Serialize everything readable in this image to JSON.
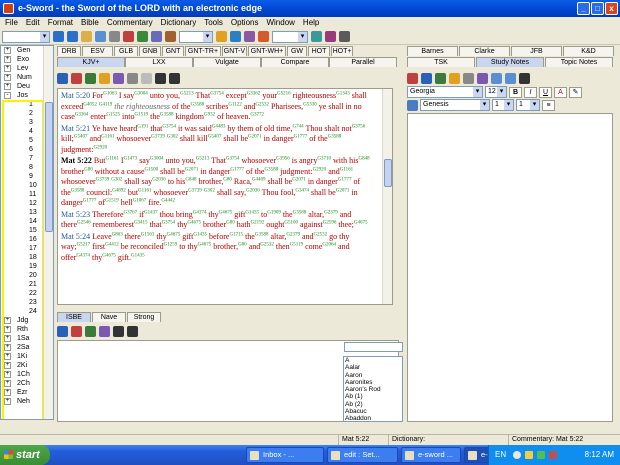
{
  "window": {
    "title": "e-Sword - the Sword of the LORD with an electronic edge",
    "minimize": "_",
    "maximize": "□",
    "close": "x"
  },
  "menu": [
    "File",
    "Edit",
    "Format",
    "Bible",
    "Commentary",
    "Dictionary",
    "Tools",
    "Options",
    "Window",
    "Help"
  ],
  "sidebar": {
    "books_top": [
      {
        "pm": "+",
        "name": "Gen"
      },
      {
        "pm": "+",
        "name": "Exo"
      },
      {
        "pm": "+",
        "name": "Lev"
      },
      {
        "pm": "+",
        "name": "Num"
      },
      {
        "pm": "+",
        "name": "Deu"
      },
      {
        "pm": "-",
        "name": "Jos"
      }
    ],
    "chapters": [
      "1",
      "2",
      "3",
      "4",
      "5",
      "6",
      "7",
      "8",
      "9",
      "10",
      "11",
      "12",
      "13",
      "14",
      "15",
      "16",
      "17",
      "18",
      "19",
      "20",
      "21",
      "22",
      "23",
      "24"
    ],
    "books_bottom": [
      {
        "pm": "+",
        "name": "Jdg"
      },
      {
        "pm": "+",
        "name": "Rth"
      },
      {
        "pm": "+",
        "name": "1Sa"
      },
      {
        "pm": "+",
        "name": "2Sa"
      },
      {
        "pm": "+",
        "name": "1Ki"
      },
      {
        "pm": "+",
        "name": "2Ki"
      },
      {
        "pm": "+",
        "name": "1Ch"
      },
      {
        "pm": "+",
        "name": "2Ch"
      },
      {
        "pm": "+",
        "name": "Ezr"
      },
      {
        "pm": "+",
        "name": "Neh"
      }
    ]
  },
  "bible_tabs_row1": [
    "DRB",
    "ESV",
    "GLB",
    "GNB",
    "GNT",
    "GNT-TR+",
    "GNT-V",
    "GNT-WH+",
    "GW",
    "HOT",
    "HOT+"
  ],
  "bible_tabs_row2": [
    "KJV+",
    "LXX",
    "Vulgate",
    "Compare",
    "Parallel"
  ],
  "verses": [
    {
      "ref": "Mat 5:20",
      "current": false,
      "html": "For<sup class='sn'>G1063</sup> I say<sup class='sn'>G3004</sup> unto you,<sup class='sn'>G5213</sup> That<sup class='sn'>G3754</sup> except<sup class='sn'>G3362</sup> your<sup class='sn'>G5216</sup> righteousness<sup class='sn'>G1343</sup> shall exceed<sup class='sn'>G4052</sup> <sup class='sn'>G4119</sup> <span class='it'>the righteousness</span> of the<sup class='sn'>G3588</sup> scribes<sup class='sn'>G1122</sup> and<sup class='sn'>G2532</sup> Pharisees,<sup class='sn'>G5330</sup> ye shall in no case<sup class='sn'>G3364</sup> enter<sup class='sn'>G1525</sup> into<sup class='sn'>G1519</sup> the<sup class='sn'>G3588</sup> kingdom<sup class='sn'>G932</sup> of heaven.<sup class='sn'>G3772</sup>"
    },
    {
      "ref": "Mat 5:21",
      "current": false,
      "html": "Ye have heard<sup class='sn'>G191</sup> that<sup class='sn'>G3754</sup> it was said<sup class='sn'>G4483</sup> by them of old time,<sup class='sn'>G744</sup> Thou shalt not<sup class='sn'>G3756</sup> kill;<sup class='sn'>G5407</sup> and<sup class='sn'>G1161</sup> whosoever<sup class='sn'>G3739</sup> <sup class='sn'>G302</sup> shall kill<sup class='sn'>G5407</sup> shall be<sup class='sn'>G2071</sup> in danger<sup class='sn'>G1777</sup> of the<sup class='sn'>G3588</sup> judgment:<sup class='sn'>G2920</sup>"
    },
    {
      "ref": "Mat 5:22",
      "current": true,
      "html": "But<sup class='sn'>G1161</sup> I<sup class='sn'>G1473</sup> say<sup class='sn'>G3004</sup> unto you,<sup class='sn'>G5213</sup> That<sup class='sn'>G3754</sup> whosoever<sup class='sn'>G3956</sup> is angry<sup class='sn'>G3710</sup> with his<sup class='sn'>G848</sup> brother<sup class='sn'>G80</sup> without a cause<sup class='sn'>G1500</sup> shall be<sup class='sn'>G2071</sup> in danger<sup class='sn'>G1777</sup> of the<sup class='sn'>G3588</sup> judgment:<sup class='sn'>G2920</sup> and<sup class='sn'>G1161</sup> whosoever<sup class='sn'>G3739</sup> <sup class='sn'>G302</sup> shall say<sup class='sn'>G2036</sup> to his<sup class='sn'>G848</sup> brother,<sup class='sn'>G80</sup> Raca,<sup class='sn'>G4469</sup> shall be<sup class='sn'>G2071</sup> in danger<sup class='sn'>G1777</sup> of the<sup class='sn'>G3588</sup> council:<sup class='sn'>G4892</sup> but<sup class='sn'>G1161</sup> whosoever<sup class='sn'>G3739</sup> <sup class='sn'>G302</sup> shall say,<sup class='sn'>G2036</sup> Thou fool,<sup class='sn'>G3474</sup> shall be<sup class='sn'>G2071</sup> in danger<sup class='sn'>G1777</sup> of<sup class='sn'>G1519</sup> hell<sup class='sn'>G1067</sup> fire.<sup class='sn'>G4442</sup>"
    },
    {
      "ref": "Mat 5:23",
      "current": false,
      "html": "Therefore<sup class='sn'>G3767</sup> if<sup class='sn'>G1437</sup> thou bring<sup class='sn'>G4374</sup> thy<sup class='sn'>G4675</sup> gift<sup class='sn'>G1435</sup> to<sup class='sn'>G1909</sup> the<sup class='sn'>G3588</sup> altar,<sup class='sn'>G2379</sup> and there<sup class='sn'>G2546</sup> rememberest<sup class='sn'>G3415</sup> that<sup class='sn'>G3754</sup> thy<sup class='sn'>G4675</sup> brother<sup class='sn'>G80</sup> hath<sup class='sn'>G2192</sup> ought<sup class='sn'>G5100</sup> against<sup class='sn'>G2596</sup> thee;<sup class='sn'>G4675</sup>"
    },
    {
      "ref": "Mat 5:24",
      "current": false,
      "html": "Leave<sup class='sn'>G863</sup> there<sup class='sn'>G1563</sup> thy<sup class='sn'>G4675</sup> gift<sup class='sn'>G1435</sup> before<sup class='sn'>G1715</sup> the<sup class='sn'>G3588</sup> altar,<sup class='sn'>G2379</sup> and<sup class='sn'>G2532</sup> go thy way;<sup class='sn'>G5217</sup> first<sup class='sn'>G4412</sup> be reconciled<sup class='sn'>G1259</sup> to thy<sup class='sn'>G4675</sup> brother,<sup class='sn'>G80</sup> and<sup class='sn'>G2532</sup> then<sup class='sn'>G5119</sup> come<sup class='sn'>G2064</sup> and offer<sup class='sn'>G4374</sup> thy<sup class='sn'>G4675</sup> gift.<sup class='sn'>G1435</sup>"
    }
  ],
  "lower_tabs": [
    "ISBE",
    "Nave",
    "Strong"
  ],
  "dictionary_list": [
    "A",
    "Aalar",
    "Aaron",
    "Aaronites",
    "Aaron's Rod",
    "Ab (1)",
    "Ab (2)",
    "Abacuc",
    "Abaddon"
  ],
  "commentary_tabs_row1": [
    "Barnes",
    "Clarke",
    "JFB",
    "K&D"
  ],
  "commentary_tabs_row2": [
    "TSK",
    "Study Notes",
    "Topic Notes"
  ],
  "editor": {
    "font": "Georgia",
    "size": "12",
    "bold": "B",
    "italic": "I",
    "underline": "U",
    "link_book": "Genesis",
    "link_ch": "1",
    "link_v": "1"
  },
  "status": {
    "ref": "Mat 5:22",
    "dictionary": "Dictionary:",
    "commentary": "Commentary: Mat 5:22"
  },
  "taskbar": {
    "start": "start",
    "buttons": [
      {
        "label": "Inbox - ...",
        "active": false
      },
      {
        "label": "edit : Set...",
        "active": false
      },
      {
        "label": "e-sword ...",
        "active": false
      },
      {
        "label": "e-Sword ...",
        "active": true
      },
      {
        "label": "",
        "active": false
      }
    ],
    "lang": "EN",
    "clock": "8:12 AM"
  },
  "colors": {
    "accent": "#245edb",
    "verse_text": "#b40000",
    "strongs": "#1a8a1a",
    "ref": "#1c5a9e",
    "highlight": "#f7f400"
  }
}
